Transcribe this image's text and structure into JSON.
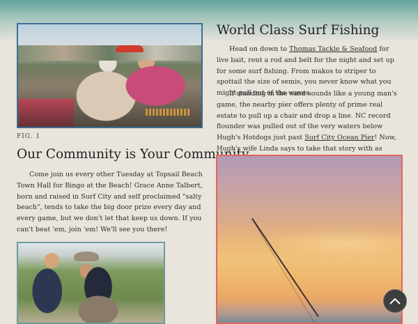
{
  "left": {
    "figure_caption": "FIG. 1",
    "community_heading": "Our Community is Your Community",
    "community_text": "Come join us every other Tuesday at Topsail Beach Town Hall for Bingo at the Beach! Grace Anne Talbert, born and raised in Surf City and self proclaimed \"salty beach\", tends to take the big door prize every day and every game, but we don't let that keep us down. If you can't beat 'em, join 'em! We'll see you there!"
  },
  "right": {
    "surf_heading": "World Class Surf Fishing",
    "p1_before": "Head on down to ",
    "p1_link": "Thomas Tackle & Seafood",
    "p1_after": " for live bait, rent a rod and belt for the night and set up for some surf fishing. From makos to striper to spottail the size of semis, you never know what you might pull out of the waves.",
    "p2_before": "If standing in the sand sounds like a young man's game, the nearby pier offers plenty of prime real estate to pull up a chair and drop a line. NC record flounder was pulled out of the very waters below Hugh's Hotdogs just past ",
    "p2_link": "Surf City Ocean Pier",
    "p2_after": "! Now, Hugh's wife Linda says to take that story with as much salt as he sprinkles on his crispy crinkle fries, but let yourself be the judge."
  },
  "icons": {
    "scroll_top": "chevron-up-icon"
  }
}
